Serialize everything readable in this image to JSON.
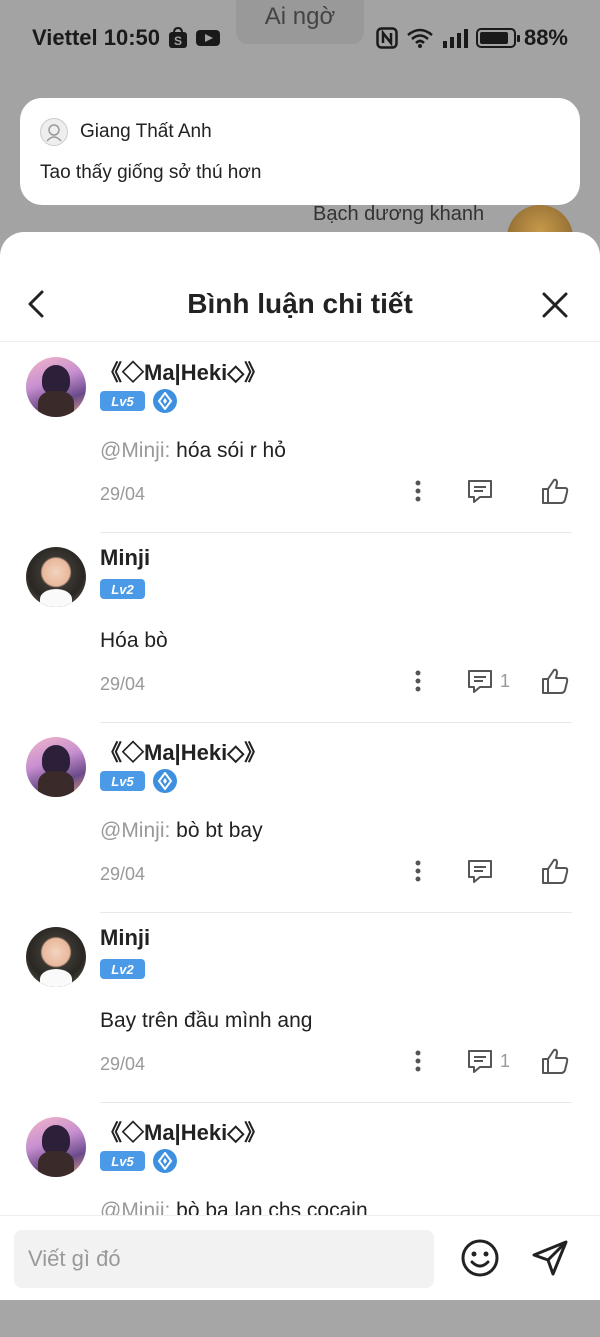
{
  "background": {
    "title_chip": "Ai ngờ",
    "chat_name": "Bạch dương khanh"
  },
  "status_bar": {
    "carrier_time": "Viettel 10:50",
    "battery_text": "88%",
    "battery_level": 0.88
  },
  "notification": {
    "sender": "Giang Thất Anh",
    "message": "Tao thấy giống sở thú hơn"
  },
  "sheet": {
    "title": "Bình luận chi tiết",
    "comments": [
      {
        "name": "《◇Ma|Heki◇》",
        "level": "Lv5",
        "vip": true,
        "avatar": "anime",
        "mention": "@Minji:",
        "text": "hóa sói r hỏ",
        "date": "29/04",
        "reply_count": ""
      },
      {
        "name": "Minji",
        "level": "Lv2",
        "vip": false,
        "avatar": "baby",
        "mention": "",
        "text": "Hóa bò",
        "date": "29/04",
        "reply_count": "1"
      },
      {
        "name": "《◇Ma|Heki◇》",
        "level": "Lv5",
        "vip": true,
        "avatar": "anime",
        "mention": "@Minji:",
        "text": "bò bt bay",
        "date": "29/04",
        "reply_count": ""
      },
      {
        "name": "Minji",
        "level": "Lv2",
        "vip": false,
        "avatar": "baby",
        "mention": "",
        "text": "Bay trên đầu mình ang",
        "date": "29/04",
        "reply_count": "1"
      },
      {
        "name": "《◇Ma|Heki◇》",
        "level": "Lv5",
        "vip": true,
        "avatar": "anime",
        "mention": "@Minji:",
        "text": "bò ba lan chs cocain",
        "date": "29/04",
        "reply_count": ""
      }
    ]
  },
  "input": {
    "placeholder": "Viết gì đó",
    "value": ""
  }
}
